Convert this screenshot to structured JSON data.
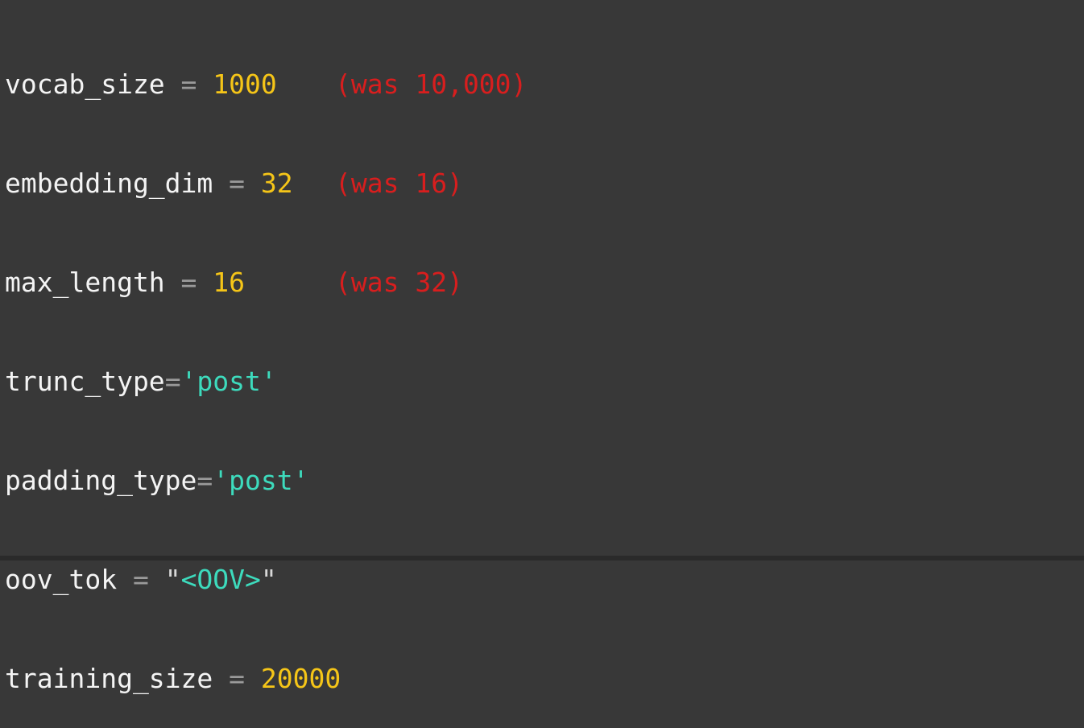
{
  "code": {
    "lines": [
      {
        "name": "vocab_size",
        "op": " = ",
        "value": "1000",
        "note": "(was 10,000)"
      },
      {
        "name": "embedding_dim",
        "op": " = ",
        "value": "32",
        "note": "(was 16)"
      },
      {
        "name": "max_length",
        "op": " = ",
        "value": "16",
        "note": "(was 32)"
      },
      {
        "name": "trunc_type",
        "op": "=",
        "value": "'post'"
      },
      {
        "name": "padding_type",
        "op": "=",
        "value": "'post'"
      },
      {
        "name": "oov_tok",
        "op": " = ",
        "quote_open": "\"",
        "value": "<OOV>",
        "quote_close": "\""
      },
      {
        "name": "training_size",
        "op": " = ",
        "value": "20000"
      }
    ]
  },
  "colors": {
    "background": "#383838",
    "identifier": "#f4f4f4",
    "operator": "#9a9a9a",
    "number": "#f5c518",
    "string": "#3ddbbd",
    "annotation": "#d81e1e"
  }
}
